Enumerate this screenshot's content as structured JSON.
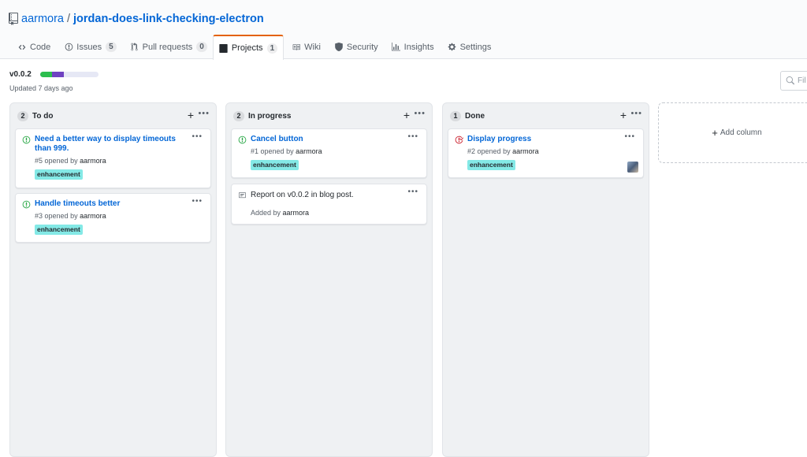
{
  "repo": {
    "owner": "aarmora",
    "separator": "/",
    "name": "jordan-does-link-checking-electron"
  },
  "tabs": [
    {
      "label": "Code",
      "icon": "code-icon"
    },
    {
      "label": "Issues",
      "icon": "issue-icon",
      "count": "5"
    },
    {
      "label": "Pull requests",
      "icon": "pull-request-icon",
      "count": "0"
    },
    {
      "label": "Projects",
      "icon": "project-icon",
      "count": "1",
      "selected": true
    },
    {
      "label": "Wiki",
      "icon": "book-icon"
    },
    {
      "label": "Security",
      "icon": "shield-icon"
    },
    {
      "label": "Insights",
      "icon": "graph-icon"
    },
    {
      "label": "Settings",
      "icon": "gear-icon"
    }
  ],
  "project": {
    "name": "v0.0.2",
    "updated": "Updated 7 days ago",
    "progress": {
      "done_fraction": 0.2,
      "in_progress_fraction": 0.2
    }
  },
  "filter": {
    "placeholder": "Fil"
  },
  "columns": [
    {
      "count": "2",
      "title": "To do",
      "cards": [
        {
          "type": "issue",
          "title": "Need a better way to display timeouts than 999.",
          "number": "#5",
          "opened": "opened by",
          "author": "aarmora",
          "label": "enhancement"
        },
        {
          "type": "issue",
          "title": "Handle timeouts better",
          "number": "#3",
          "opened": "opened by",
          "author": "aarmora",
          "label": "enhancement"
        }
      ]
    },
    {
      "count": "2",
      "title": "In progress",
      "cards": [
        {
          "type": "issue",
          "title": "Cancel button",
          "number": "#1",
          "opened": "opened by",
          "author": "aarmora",
          "label": "enhancement"
        },
        {
          "type": "note",
          "text": "Report on v0.0.2 in blog post.",
          "added": "Added by",
          "author": "aarmora"
        }
      ]
    },
    {
      "count": "1",
      "title": "Done",
      "cards": [
        {
          "type": "closed-issue",
          "title": "Display progress",
          "number": "#2",
          "opened": "opened by",
          "author": "aarmora",
          "label": "enhancement"
        }
      ]
    }
  ],
  "add_column": {
    "label": "Add column"
  },
  "colors": {
    "link": "#0366d6",
    "label_bg": "#84e9e6",
    "open_green": "#28a745",
    "closed_red": "#cb2431",
    "tab_accent": "#e36209",
    "progress_done": "#2cbe4e",
    "progress_in_progress": "#6f42c1"
  }
}
